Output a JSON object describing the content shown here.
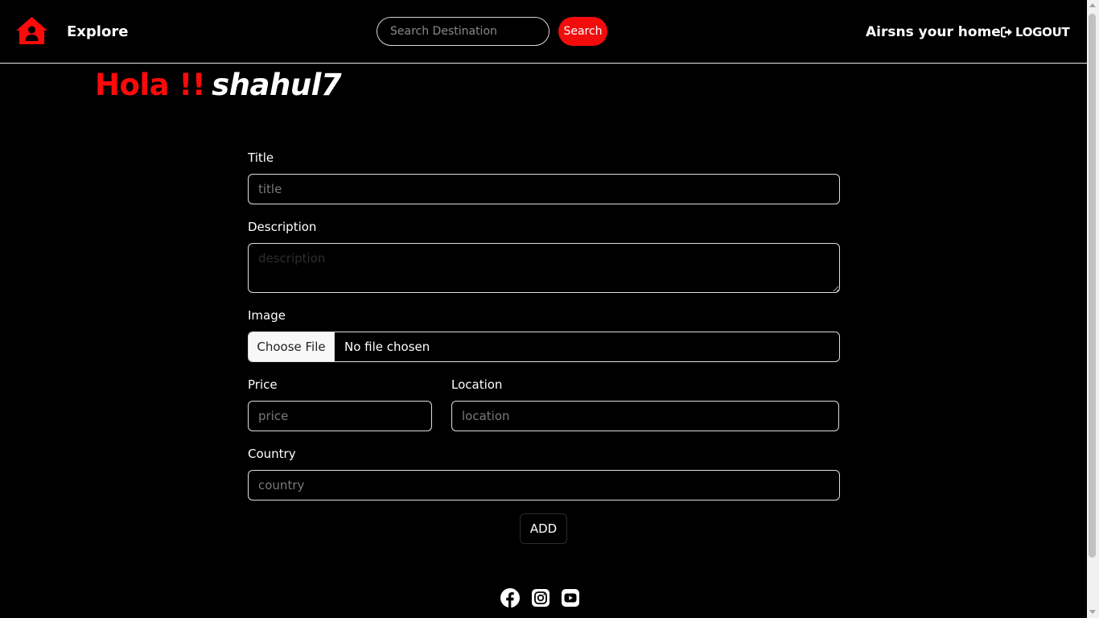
{
  "navbar": {
    "explore_label": "Explore",
    "search_placeholder": "Search Destination",
    "search_button": "Search",
    "tagline": "Airsns your home",
    "logout_label": "LOGOUT"
  },
  "greeting": {
    "hello": "Hola !!",
    "username": "shahul7"
  },
  "form": {
    "title_label": "Title",
    "title_placeholder": "title",
    "description_label": "Description",
    "description_placeholder": "description",
    "image_label": "Image",
    "file_button": "Choose File",
    "file_status": "No file chosen",
    "price_label": "Price",
    "price_placeholder": "price",
    "location_label": "Location",
    "location_placeholder": "location",
    "country_label": "Country",
    "country_placeholder": "country",
    "add_button": "ADD"
  },
  "footer": {
    "icons": [
      "facebook-icon",
      "instagram-icon",
      "youtube-icon"
    ]
  },
  "colors": {
    "accent": "#ff0a0a",
    "background": "#000000",
    "text": "#ffffff"
  }
}
